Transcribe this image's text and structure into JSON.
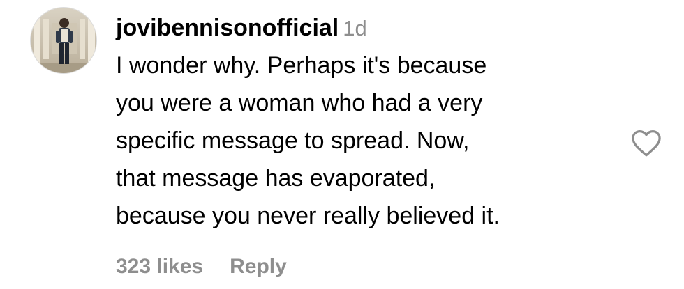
{
  "comment": {
    "username": "jovibennisonofficial",
    "time": "1d",
    "text_lines": [
      "I wonder why. Perhaps it's because",
      "you were a woman who had a very",
      "specific message to spread. Now,",
      "that message has evaporated,",
      "because you never really believed it."
    ],
    "likes": "323 likes",
    "reply": "Reply",
    "like_icon": "heart-outline-icon"
  },
  "colors": {
    "text": "#000000",
    "muted": "#8e8e8e",
    "background": "#ffffff"
  }
}
